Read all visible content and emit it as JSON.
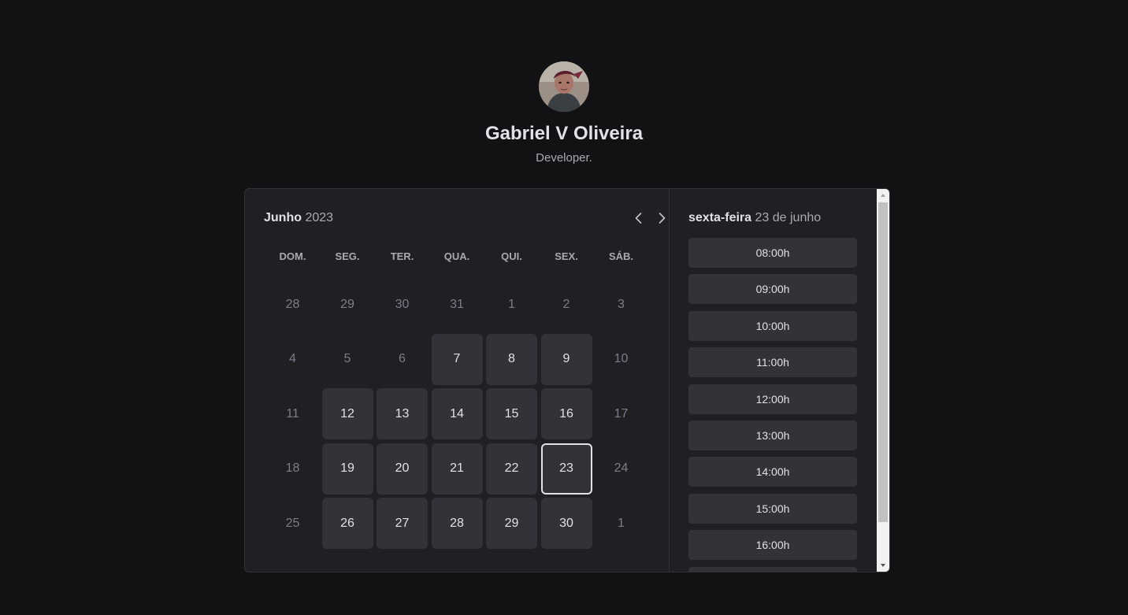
{
  "profile": {
    "name": "Gabriel V Oliveira",
    "bio": "Developer."
  },
  "calendar": {
    "month": "Junho",
    "year": "2023",
    "weekdays": [
      "DOM.",
      "SEG.",
      "TER.",
      "QUA.",
      "QUI.",
      "SEX.",
      "SÁB."
    ],
    "weeks": [
      [
        {
          "d": "28",
          "s": "disabled"
        },
        {
          "d": "29",
          "s": "disabled"
        },
        {
          "d": "30",
          "s": "disabled"
        },
        {
          "d": "31",
          "s": "disabled"
        },
        {
          "d": "1",
          "s": "disabled"
        },
        {
          "d": "2",
          "s": "disabled"
        },
        {
          "d": "3",
          "s": "disabled"
        }
      ],
      [
        {
          "d": "4",
          "s": "disabled"
        },
        {
          "d": "5",
          "s": "disabled"
        },
        {
          "d": "6",
          "s": "disabled"
        },
        {
          "d": "7",
          "s": "available"
        },
        {
          "d": "8",
          "s": "available"
        },
        {
          "d": "9",
          "s": "available"
        },
        {
          "d": "10",
          "s": "disabled"
        }
      ],
      [
        {
          "d": "11",
          "s": "disabled"
        },
        {
          "d": "12",
          "s": "available"
        },
        {
          "d": "13",
          "s": "available"
        },
        {
          "d": "14",
          "s": "available"
        },
        {
          "d": "15",
          "s": "available"
        },
        {
          "d": "16",
          "s": "available"
        },
        {
          "d": "17",
          "s": "disabled"
        }
      ],
      [
        {
          "d": "18",
          "s": "disabled"
        },
        {
          "d": "19",
          "s": "available"
        },
        {
          "d": "20",
          "s": "available"
        },
        {
          "d": "21",
          "s": "available"
        },
        {
          "d": "22",
          "s": "available"
        },
        {
          "d": "23",
          "s": "selected"
        },
        {
          "d": "24",
          "s": "disabled"
        }
      ],
      [
        {
          "d": "25",
          "s": "disabled"
        },
        {
          "d": "26",
          "s": "available"
        },
        {
          "d": "27",
          "s": "available"
        },
        {
          "d": "28",
          "s": "available"
        },
        {
          "d": "29",
          "s": "available"
        },
        {
          "d": "30",
          "s": "available"
        },
        {
          "d": "1",
          "s": "disabled"
        }
      ]
    ]
  },
  "time_picker": {
    "weekday": "sexta-feira",
    "date": "23 de junho",
    "slots": [
      "08:00h",
      "09:00h",
      "10:00h",
      "11:00h",
      "12:00h",
      "13:00h",
      "14:00h",
      "15:00h",
      "16:00h",
      ""
    ]
  },
  "icons": {
    "prev": "chevron-left-icon",
    "next": "chevron-right-icon"
  },
  "colors": {
    "background": "#121214",
    "panel": "#202024",
    "available_day": "#323238",
    "text": "#e1e1e6",
    "muted": "#7c7c8a"
  }
}
